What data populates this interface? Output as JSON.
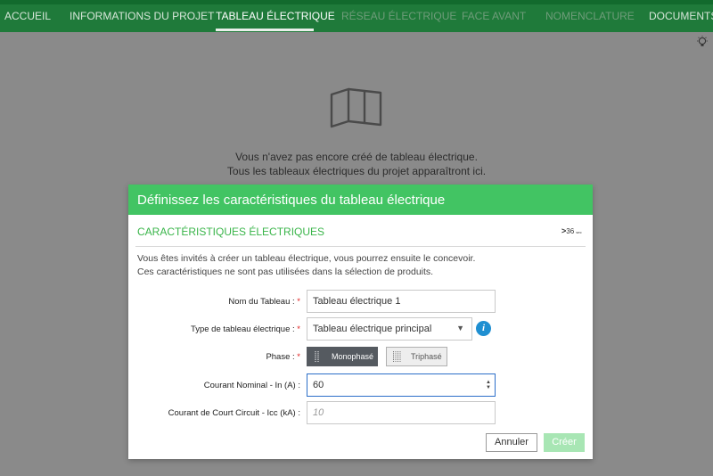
{
  "nav": {
    "tabs": [
      {
        "label": "ACCUEIL",
        "state": "normal"
      },
      {
        "label": "INFORMATIONS DU PROJET",
        "state": "normal"
      },
      {
        "label": "TABLEAU ÉLECTRIQUE",
        "state": "active"
      },
      {
        "label": "RÉSEAU ÉLECTRIQUE",
        "state": "disabled"
      },
      {
        "label": "FACE AVANT",
        "state": "disabled"
      },
      {
        "label": "NOMENCLATURE",
        "state": "disabled"
      },
      {
        "label": "DOCUMENTS",
        "state": "normal"
      }
    ],
    "help_icon": "lightbulb-icon"
  },
  "empty_state": {
    "icon": "switchboard-icon",
    "line1": "Vous n'avez pas encore créé de tableau électrique.",
    "line2": "Tous les tableaux électriques du projet apparaîtront ici."
  },
  "modal": {
    "title": "Définissez les caractéristiques du tableau électrique",
    "section_title": "CARACTÉRISTIQUES ÉLECTRIQUES",
    "collapse_value": "36",
    "collapse_unit": "sec",
    "intro_line1": "Vous êtes invités à créer un tableau électrique, vous pourrez ensuite le concevoir.",
    "intro_line2": "Ces caractéristiques ne sont pas utilisées dans la sélection de produits.",
    "fields": {
      "name": {
        "label": "Nom du Tableau :",
        "required": "*",
        "value": "Tableau électrique 1"
      },
      "type": {
        "label": "Type de tableau électrique :",
        "required": "*",
        "value": "Tableau électrique principal"
      },
      "phase": {
        "label": "Phase :",
        "required": "*",
        "options": [
          "Monophasé",
          "Triphasé"
        ],
        "selected": "Monophasé"
      },
      "nominal_current": {
        "label": "Courant Nominal - In (A) :",
        "value": "60"
      },
      "short_circuit": {
        "label": "Courant de Court Circuit - Icc (kA) :",
        "placeholder": "10"
      }
    },
    "buttons": {
      "cancel": "Annuler",
      "create": "Créer"
    }
  },
  "colors": {
    "nav_bg": "#1f7a3a",
    "modal_header": "#42c463",
    "section_title": "#3ab54a",
    "focus_border": "#2c6fc9",
    "info_icon": "#1f8fd1",
    "required": "#e02020",
    "create_button_disabled": "#a8e6b4"
  }
}
